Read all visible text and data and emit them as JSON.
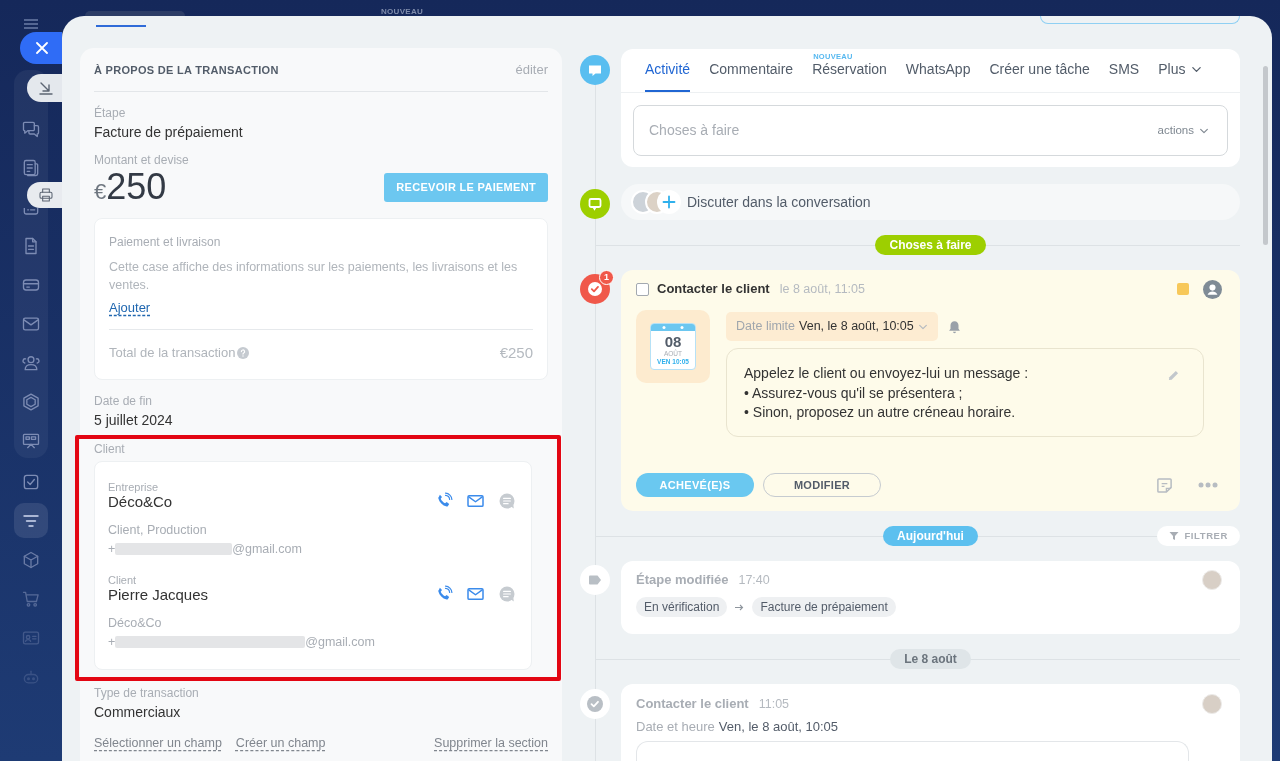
{
  "header": {
    "badge": "NOUVEAU"
  },
  "sidebar": {
    "items": [
      {
        "selected": false
      },
      {
        "selected": false
      },
      {
        "selected": false
      },
      {
        "selected": false
      },
      {
        "selected": false
      },
      {
        "selected": false
      },
      {
        "selected": false
      },
      {
        "selected": false
      },
      {
        "selected": false
      },
      {
        "selected": false
      },
      {
        "selected": true
      },
      {
        "selected": false
      },
      {
        "selected": false
      },
      {
        "selected": false
      },
      {
        "selected": false
      }
    ]
  },
  "about": {
    "title": "À PROPOS DE LA TRANSACTION",
    "edit": "éditer",
    "stage": {
      "label": "Étape",
      "value": "Facture de prépaiement"
    },
    "amount": {
      "label": "Montant et devise",
      "currency": "€",
      "value": "250",
      "button": "RECEVOIR LE PAIEMENT"
    },
    "payment": {
      "title": "Paiement et livraison",
      "description": "Cette case affiche des informations sur les paiements, les livraisons et les ventes.",
      "link": "Ajouter",
      "total_label": "Total de la transaction",
      "total": "€250"
    },
    "end_date": {
      "label": "Date de fin",
      "value": "5 juillet 2024"
    },
    "client": {
      "label": "Client",
      "highlighted": true,
      "contacts": [
        {
          "role": "Entreprise",
          "name": "Déco&Co",
          "details": "Client, Production",
          "contact_prefix": "+",
          "contact_suffix": "@gmail.com"
        },
        {
          "role": "Client",
          "name": "Pierre Jacques",
          "details": "Déco&Co",
          "contact_prefix": "+",
          "contact_suffix": "@gmail.com"
        }
      ]
    },
    "deal_type": {
      "label": "Type de transaction",
      "value": "Commerciaux"
    },
    "links": [
      "Sélectionner un champ",
      "Créer un champ"
    ],
    "remove_link": "Supprimer la section"
  },
  "composer": {
    "tabs": [
      {
        "label": "Activité",
        "selected": true,
        "kind": "tab"
      },
      {
        "label": "Commentaire",
        "selected": false,
        "kind": "tab"
      },
      {
        "label": "Réservation",
        "selected": false,
        "kind": "tab",
        "badge": "NOUVEAU"
      },
      {
        "label": "WhatsApp",
        "selected": false,
        "kind": "tab"
      },
      {
        "label": "Créer une tâche",
        "selected": false,
        "kind": "tab"
      },
      {
        "label": "SMS",
        "selected": false,
        "kind": "tab"
      },
      {
        "label": "Plus",
        "selected": false,
        "kind": "menu"
      }
    ],
    "placeholder": "Choses à faire",
    "actions": "actions"
  },
  "chat": {
    "text": "Discuter dans la conversation"
  },
  "timeline": [
    {
      "kind": "divider",
      "label": "Choses à faire",
      "color": "#9dcf00"
    },
    {
      "kind": "task",
      "checked": false,
      "title": "Contacter le client",
      "time": "le 8 août, 11:05",
      "counter": "1",
      "calendar": {
        "day": "08",
        "month": "AOÛT",
        "weekday_time": "VEN 10:05"
      },
      "deadline_label": "Date limite",
      "deadline": "Ven, le 8 août, 10:05",
      "description": [
        "Appelez le client ou envoyez-lui un message :",
        "• Assurez-vous qu'il se présentera ;",
        "• Sinon, proposez un autre créneau horaire."
      ],
      "buttons": [
        "ACHEVÉ(E)S",
        "MODIFIER"
      ]
    },
    {
      "kind": "divider",
      "label": "Aujourd'hui",
      "color": "#5cc0ef",
      "filter": "FILTRER"
    },
    {
      "kind": "event",
      "title": "Étape modifiée",
      "time": "17:40",
      "from": "En vérification",
      "to": "Facture de prépaiement"
    },
    {
      "kind": "divider",
      "label": "Le 8 août",
      "color": "#dfe5e8"
    },
    {
      "kind": "done",
      "title": "Contacter le client",
      "time": "11:05",
      "date_label": "Date et heure",
      "date": "Ven, le 8 août, 10:05"
    }
  ]
}
